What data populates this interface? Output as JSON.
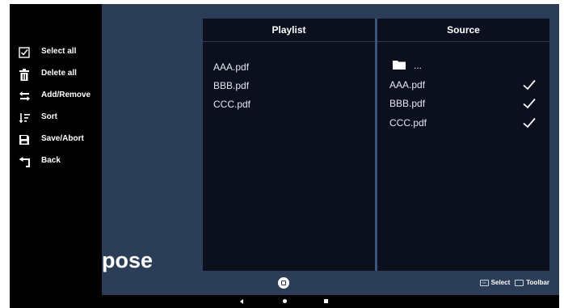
{
  "toolbar": {
    "items": [
      {
        "label": "Select all",
        "icon": "checkbox-icon"
      },
      {
        "label": "Delete all",
        "icon": "trash-icon"
      },
      {
        "label": "Add/Remove",
        "icon": "swap-arrows-icon"
      },
      {
        "label": "Sort",
        "icon": "sort-icon"
      },
      {
        "label": "Save/Abort",
        "icon": "save-icon"
      },
      {
        "label": "Back",
        "icon": "back-arrow-icon"
      }
    ]
  },
  "background_text": "pose",
  "playlist": {
    "title": "Playlist",
    "items": [
      "AAA.pdf",
      "BBB.pdf",
      "CCC.pdf"
    ]
  },
  "source": {
    "title": "Source",
    "folder_label": "...",
    "items": [
      {
        "name": "AAA.pdf",
        "checked": true
      },
      {
        "name": "BBB.pdf",
        "checked": true
      },
      {
        "name": "CCC.pdf",
        "checked": true
      }
    ]
  },
  "hints": {
    "ok_key": "OK",
    "select_label": "Select",
    "toolbar_label": "Toolbar"
  },
  "colors": {
    "background": "#2c3e57",
    "panel": "#0b0f1e",
    "toolbar": "#000000"
  }
}
